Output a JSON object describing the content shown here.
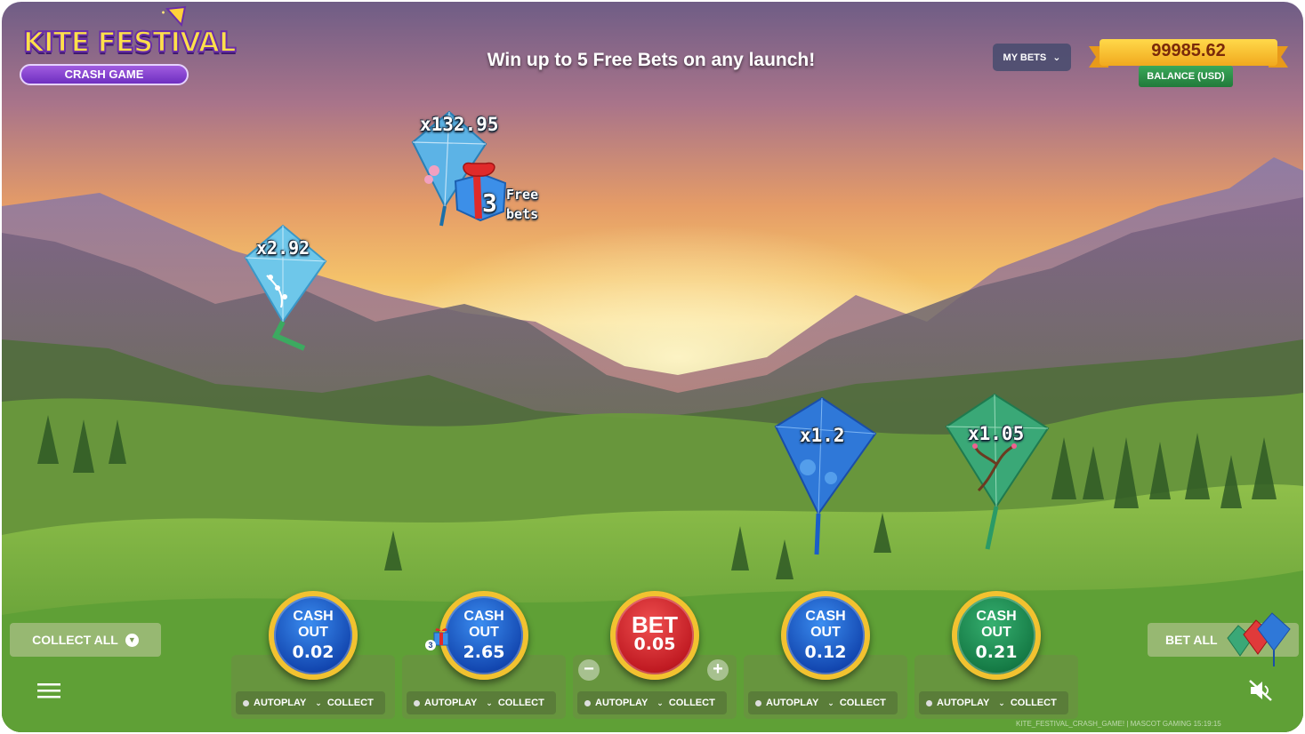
{
  "logo": {
    "title": "KITE FESTIVAL",
    "subtitle": "CRASH GAME"
  },
  "promo": "Win up to 5 Free Bets on any launch!",
  "header": {
    "my_bets": "MY BETS",
    "balance_value": "99985.62",
    "balance_label": "BALANCE (USD)"
  },
  "kites": [
    {
      "multiplier": "x132.95",
      "color": "#5cb3e6",
      "gift_count": "3",
      "gift_text_1": "Free",
      "gift_text_2": "bets"
    },
    {
      "multiplier": "x2.92",
      "color": "#6ec7ea"
    },
    {
      "multiplier": "x1.2",
      "color": "#2f78d8"
    },
    {
      "multiplier": "x1.05",
      "color": "#3aa877"
    }
  ],
  "controls": {
    "collect_all": "COLLECT ALL",
    "bet_all": "BET ALL",
    "slots": [
      {
        "label_1": "CASH",
        "label_2": "OUT",
        "value": "0.02",
        "style": "blue",
        "autoplay": "AUTOPLAY",
        "collect": "COLLECT"
      },
      {
        "label_1": "CASH",
        "label_2": "OUT",
        "value": "2.65",
        "style": "blue",
        "badge": "3",
        "autoplay": "AUTOPLAY",
        "collect": "COLLECT"
      },
      {
        "label_1": "BET",
        "label_2": "",
        "value": "0.05",
        "style": "red",
        "autoplay": "AUTOPLAY",
        "collect": "COLLECT",
        "minus": "−",
        "plus": "+"
      },
      {
        "label_1": "CASH",
        "label_2": "OUT",
        "value": "0.12",
        "style": "blue",
        "autoplay": "AUTOPLAY",
        "collect": "COLLECT"
      },
      {
        "label_1": "CASH",
        "label_2": "OUT",
        "value": "0.21",
        "style": "green",
        "autoplay": "AUTOPLAY",
        "collect": "COLLECT"
      }
    ]
  },
  "footer": "KITE_FESTIVAL_CRASH_GAME! | MASCOT GAMING    15:19:15",
  "colors": {
    "gold_ring": "#f2c230",
    "blue_btn": "#1347b0",
    "green_btn": "#157a45",
    "red_btn": "#c01a22"
  }
}
